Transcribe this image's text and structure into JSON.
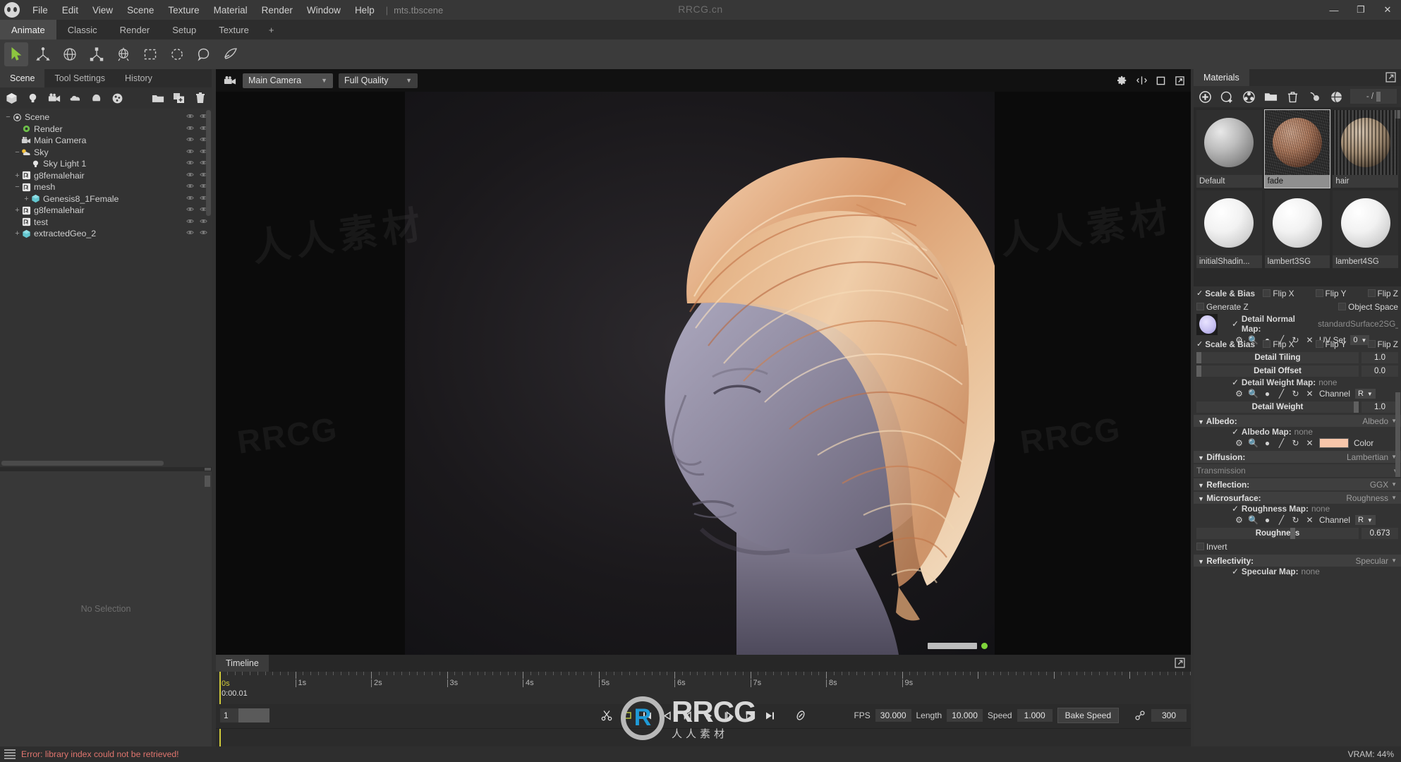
{
  "app": {
    "scene_file": "mts.tbscene",
    "watermark_top": "RRCG.cn"
  },
  "menubar": {
    "logo_icon": "skull-logo-icon",
    "items": [
      "File",
      "Edit",
      "View",
      "Scene",
      "Texture",
      "Material",
      "Render",
      "Window",
      "Help"
    ],
    "separator": "|",
    "window_buttons": [
      {
        "name": "minimize-button",
        "glyph": "—"
      },
      {
        "name": "maximize-button",
        "glyph": "❐"
      },
      {
        "name": "close-button",
        "glyph": "✕"
      }
    ]
  },
  "workspace_tabs": {
    "tabs": [
      "Animate",
      "Classic",
      "Render",
      "Setup",
      "Texture"
    ],
    "active": "Animate",
    "add_label": "+"
  },
  "toolbar": {
    "tools": [
      {
        "name": "select-tool",
        "icon": "cursor-arrow-icon",
        "active": true
      },
      {
        "name": "move-tool",
        "icon": "move-axis-icon",
        "active": false
      },
      {
        "name": "rotate-tool",
        "icon": "rotate-globe-icon",
        "active": false
      },
      {
        "name": "scale-tool",
        "icon": "scale-axis-icon",
        "active": false
      },
      {
        "name": "transform-tool",
        "icon": "transform-globe-icon",
        "active": false
      },
      {
        "name": "rect-select-tool",
        "icon": "rectangle-select-icon",
        "active": false
      },
      {
        "name": "circle-select-tool",
        "icon": "circle-select-icon",
        "active": false
      },
      {
        "name": "lasso-select-tool",
        "icon": "lasso-select-icon",
        "active": false
      },
      {
        "name": "paint-select-tool",
        "icon": "paint-arrow-icon",
        "active": false
      }
    ]
  },
  "left_panel": {
    "tabs": [
      "Scene",
      "Tool Settings",
      "History"
    ],
    "active_tab": "Scene",
    "icon_row": [
      {
        "name": "add-object-icon",
        "icon": "cube-icon"
      },
      {
        "name": "add-light-icon",
        "icon": "bulb-icon"
      },
      {
        "name": "add-camera-icon",
        "icon": "camera-icon"
      },
      {
        "name": "add-sky-icon",
        "icon": "cloud-icon"
      },
      {
        "name": "add-mesh-icon",
        "icon": "mesh-icon"
      },
      {
        "name": "add-material-icon",
        "icon": "sphere-material-icon"
      },
      {
        "name": "open-folder-icon",
        "icon": "folder-icon"
      },
      {
        "name": "duplicate-icon",
        "icon": "copy-plus-icon"
      },
      {
        "name": "delete-icon",
        "icon": "trash-icon"
      }
    ],
    "tree": [
      {
        "label": "Scene",
        "depth": 0,
        "expander": "−",
        "icon": "scene-icon"
      },
      {
        "label": "Render",
        "depth": 1,
        "expander": "",
        "icon": "render-gear-icon"
      },
      {
        "label": "Main Camera",
        "depth": 1,
        "expander": "",
        "icon": "camera-icon"
      },
      {
        "label": "Sky",
        "depth": 1,
        "expander": "−",
        "icon": "sky-icon"
      },
      {
        "label": "Sky Light 1",
        "depth": 2,
        "expander": "",
        "icon": "bulb-icon"
      },
      {
        "label": "g8femalehair",
        "depth": 1,
        "expander": "+",
        "icon": "mesh-node-icon"
      },
      {
        "label": "mesh",
        "depth": 1,
        "expander": "−",
        "icon": "mesh-node-icon"
      },
      {
        "label": "Genesis8_1Female",
        "depth": 2,
        "expander": "+",
        "icon": "geo-cube-icon"
      },
      {
        "label": "g8femalehair",
        "depth": 1,
        "expander": "+",
        "icon": "mesh-node-icon"
      },
      {
        "label": "test",
        "depth": 1,
        "expander": "",
        "icon": "mesh-node-icon"
      },
      {
        "label": "extractedGeo_2",
        "depth": 1,
        "expander": "+",
        "icon": "geo-cube-icon"
      }
    ],
    "properties_placeholder": "No Selection"
  },
  "viewport": {
    "camera_icon": "camera-icon",
    "camera": "Main Camera",
    "quality": "Full Quality",
    "right_icons": [
      {
        "name": "viewport-settings-icon",
        "icon": "gear-icon"
      },
      {
        "name": "viewport-split-icon",
        "icon": "split-icon"
      },
      {
        "name": "viewport-maximize-icon",
        "icon": "square-icon"
      },
      {
        "name": "viewport-popout-icon",
        "icon": "popout-icon"
      }
    ],
    "render_progress_percent": 100,
    "status_dot_color": "#7fd43a"
  },
  "timeline": {
    "tab_label": "Timeline",
    "popout_icon": "popout-icon",
    "playhead_frame_label": "0s",
    "playhead_time": "0:00.01",
    "tick_labels": [
      "0s",
      "1s",
      "2s",
      "3s",
      "4s",
      "5s",
      "6s",
      "7s",
      "8s",
      "9s"
    ],
    "current_frame": "1",
    "transport": [
      {
        "name": "cut-keys-button",
        "icon": "scissors-icon"
      },
      {
        "name": "loop-button",
        "icon": "loop-icon"
      },
      {
        "name": "go-to-start-button",
        "icon": "skip-back-icon"
      },
      {
        "name": "play-backward-button",
        "icon": "play-back-icon"
      },
      {
        "name": "step-back-button",
        "icon": "step-back-icon"
      },
      {
        "name": "play-button",
        "icon": "play-icon"
      },
      {
        "name": "step-forward-button",
        "icon": "step-forward-icon"
      },
      {
        "name": "next-key-button",
        "icon": "play-next-icon"
      },
      {
        "name": "go-to-end-button",
        "icon": "skip-forward-icon"
      },
      {
        "name": "settings-button",
        "icon": "toggle-icon"
      }
    ],
    "fps_label": "FPS",
    "fps_value": "30.000",
    "length_label": "Length",
    "length_value": "10.000",
    "speed_label": "Speed",
    "speed_value": "1.000",
    "bake_speed_label": "Bake Speed",
    "link_icon": "link-icon",
    "end_frame": "300"
  },
  "right_panel": {
    "tab_label": "Materials",
    "popout_icon": "popout-icon",
    "icons": [
      {
        "name": "add-material-icon",
        "icon": "plus-circle-icon"
      },
      {
        "name": "duplicate-material-icon",
        "icon": "sphere-plus-icon"
      },
      {
        "name": "material-grid-icon",
        "icon": "checker-sphere-icon"
      },
      {
        "name": "open-material-folder-icon",
        "icon": "folder-icon"
      },
      {
        "name": "delete-material-icon",
        "icon": "trash-icon"
      },
      {
        "name": "pick-material-icon",
        "icon": "eyedropper-icon"
      },
      {
        "name": "assign-material-icon",
        "icon": "globe-icon"
      },
      {
        "name": "refresh-material-icon",
        "icon": "refresh-sphere-icon"
      }
    ],
    "counter": "- /",
    "materials": [
      {
        "name": "Default",
        "thumb": "grey-sphere",
        "selected": false
      },
      {
        "name": "fade",
        "thumb": "fade-sphere",
        "selected": true
      },
      {
        "name": "hair",
        "thumb": "hair-sphere",
        "selected": false
      },
      {
        "name": "initialShadin...",
        "thumb": "white-sphere",
        "selected": false
      },
      {
        "name": "lambert3SG",
        "thumb": "white-sphere",
        "selected": false
      },
      {
        "name": "lambert4SG",
        "thumb": "white-sphere",
        "selected": false
      }
    ],
    "properties": {
      "normal_scale_bias": "Scale & Bias",
      "normal_flip_x": "Flip X",
      "normal_flip_y": "Flip Y",
      "normal_flip_z": "Flip Z",
      "generate_z": "Generate Z",
      "object_space": "Object Space",
      "detail_normal_map_label": "Detail Normal Map:",
      "detail_normal_map_value": "standardSurface2SG_",
      "uv_set_label": "UV Set",
      "uv_set_value": "0",
      "detail_scale_bias": "Scale & Bias",
      "detail_flip_x": "Flip X",
      "detail_flip_y": "Flip Y",
      "detail_flip_z": "Flip Z",
      "detail_tiling_label": "Detail Tiling",
      "detail_tiling_value": "1.0",
      "detail_offset_label": "Detail Offset",
      "detail_offset_value": "0.0",
      "detail_weight_map_label": "Detail Weight Map:",
      "detail_weight_map_value": "none",
      "detail_weight_channel_label": "Channel",
      "detail_weight_channel_value": "R",
      "detail_weight_label": "Detail Weight",
      "detail_weight_value": "1.0",
      "albedo_section": "Albedo:",
      "albedo_mode": "Albedo",
      "albedo_map_label": "Albedo Map:",
      "albedo_map_value": "none",
      "albedo_color_label": "Color",
      "albedo_color_hex": "#f7c6aa",
      "diffusion_section": "Diffusion:",
      "diffusion_mode": "Lambertian",
      "transmission_label": "Transmission",
      "reflection_section": "Reflection:",
      "reflection_mode": "GGX",
      "microsurface_section": "Microsurface:",
      "microsurface_mode": "Roughness",
      "roughness_map_label": "Roughness Map:",
      "roughness_map_value": "none",
      "roughness_channel_label": "Channel",
      "roughness_channel_value": "R",
      "roughness_label": "Roughness",
      "roughness_value": "0.673",
      "invert_label": "Invert",
      "reflectivity_section": "Reflectivity:",
      "reflectivity_mode": "Specular",
      "specular_map_label": "Specular Map:",
      "specular_map_value": "none"
    }
  },
  "statusbar": {
    "console_icon": "console-icon",
    "error_message": "Error: library index could not be retrieved!",
    "vram": "VRAM: 44%"
  },
  "overlay_watermarks": {
    "brand": "RRCG",
    "brand_sub": "人人素材",
    "cn1": "人人素材",
    "cn2": "人人素材",
    "rr1": "RRCG",
    "rr2": "RRCG"
  }
}
